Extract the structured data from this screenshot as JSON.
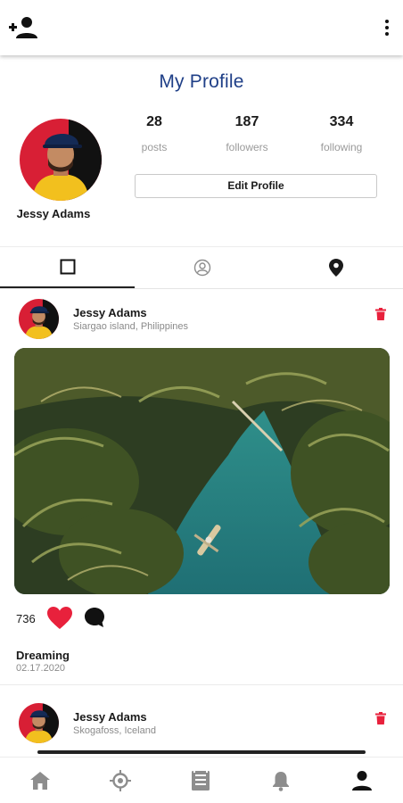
{
  "page": {
    "title": "My Profile"
  },
  "profile": {
    "name": "Jessy Adams",
    "stats": [
      {
        "value": "28",
        "label": "posts"
      },
      {
        "value": "187",
        "label": "followers"
      },
      {
        "value": "334",
        "label": "following"
      }
    ],
    "edit_label": "Edit Profile"
  },
  "tabs": [
    {
      "icon": "grid-square-icon",
      "active": true
    },
    {
      "icon": "user-circle-icon",
      "active": false
    },
    {
      "icon": "location-pin-icon",
      "active": false
    }
  ],
  "posts": [
    {
      "user": "Jessy Adams",
      "location": "Siargao island, Philippines",
      "likes": "736",
      "caption": "Dreaming",
      "date": "02.17.2020"
    },
    {
      "user": "Jessy Adams",
      "location": "Skogafoss, Iceland"
    }
  ],
  "icons": {
    "appbar_left": "add-user-icon",
    "appbar_right": "more-vert-icon",
    "delete": "trash-icon",
    "like": "heart-icon",
    "comment": "comment-icon"
  },
  "bottom_nav": [
    {
      "icon": "home-icon",
      "active": false
    },
    {
      "icon": "explore-icon",
      "active": false
    },
    {
      "icon": "feed-icon",
      "active": false
    },
    {
      "icon": "bell-icon",
      "active": false
    },
    {
      "icon": "profile-icon",
      "active": true
    }
  ],
  "colors": {
    "title": "#1f3f87",
    "accent_red": "#e8213c",
    "icon_gray": "#8d8d8d",
    "active_black": "#111111"
  }
}
